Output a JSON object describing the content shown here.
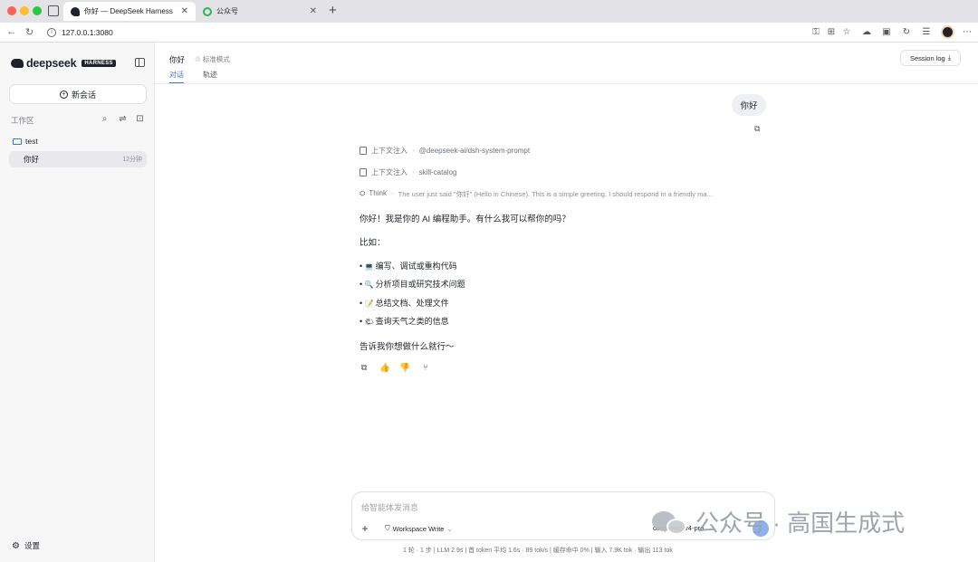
{
  "browser": {
    "tabs": [
      {
        "title": "你好 — DeepSeek Harness",
        "active": true
      },
      {
        "title": "公众号",
        "active": false
      }
    ],
    "url": "127.0.0.1:3080"
  },
  "sidebar": {
    "brand": "deepseek",
    "brand_badge": "HARNESS",
    "new_chat_label": "新会话",
    "workspace_label": "工作区",
    "folder_name": "test",
    "sessions": [
      {
        "title": "你好",
        "time": "12分钟"
      }
    ],
    "settings_label": "设置"
  },
  "header": {
    "title": "你好",
    "mode": "标准模式",
    "tabs": [
      "对话",
      "轨迹"
    ],
    "session_log_label": "Session log"
  },
  "conversation": {
    "user_message": "你好",
    "context_injections": [
      {
        "label": "上下文注入",
        "detail": "@deepseek-ai/dsh-system-prompt"
      },
      {
        "label": "上下文注入",
        "detail": "skill-catalog"
      }
    ],
    "think": {
      "label": "Think",
      "text": "The user just said \"你好\" (Hello in Chinese). This is a simple greeting. I should respond in a friendly ma..."
    },
    "answer_intro": "你好！我是你的 AI 编程助手。有什么我可以帮你的吗？",
    "answer_lead": "比如：",
    "bullets": [
      {
        "icon": "laptop-icon",
        "text": "编写、调试或重构代码"
      },
      {
        "icon": "magnifier-icon",
        "text": "分析项目或研究技术问题"
      },
      {
        "icon": "memo-icon",
        "text": "总结文档、处理文件"
      },
      {
        "icon": "weather-icon",
        "text": "查询天气之类的信息"
      }
    ],
    "answer_outro": "告诉我你想做什么就行～"
  },
  "composer": {
    "placeholder": "给智能体发消息",
    "mode_label": "Workspace Write",
    "model_label": "deepseek-v4-pro"
  },
  "status_bar": "1 轮 · 1 步  |  LLM 2.9s  |  首 token 平均 1.6s · 89 tok/s  |  缓存命中 0%  |  输入 7.9K tok · 输出 113 tok",
  "watermark": "公众号 · 高国生成式",
  "colors": {
    "accent": "#3a74e0",
    "sidebar_bg": "#f7f7f8",
    "bubble_bg": "#eef0f5"
  }
}
